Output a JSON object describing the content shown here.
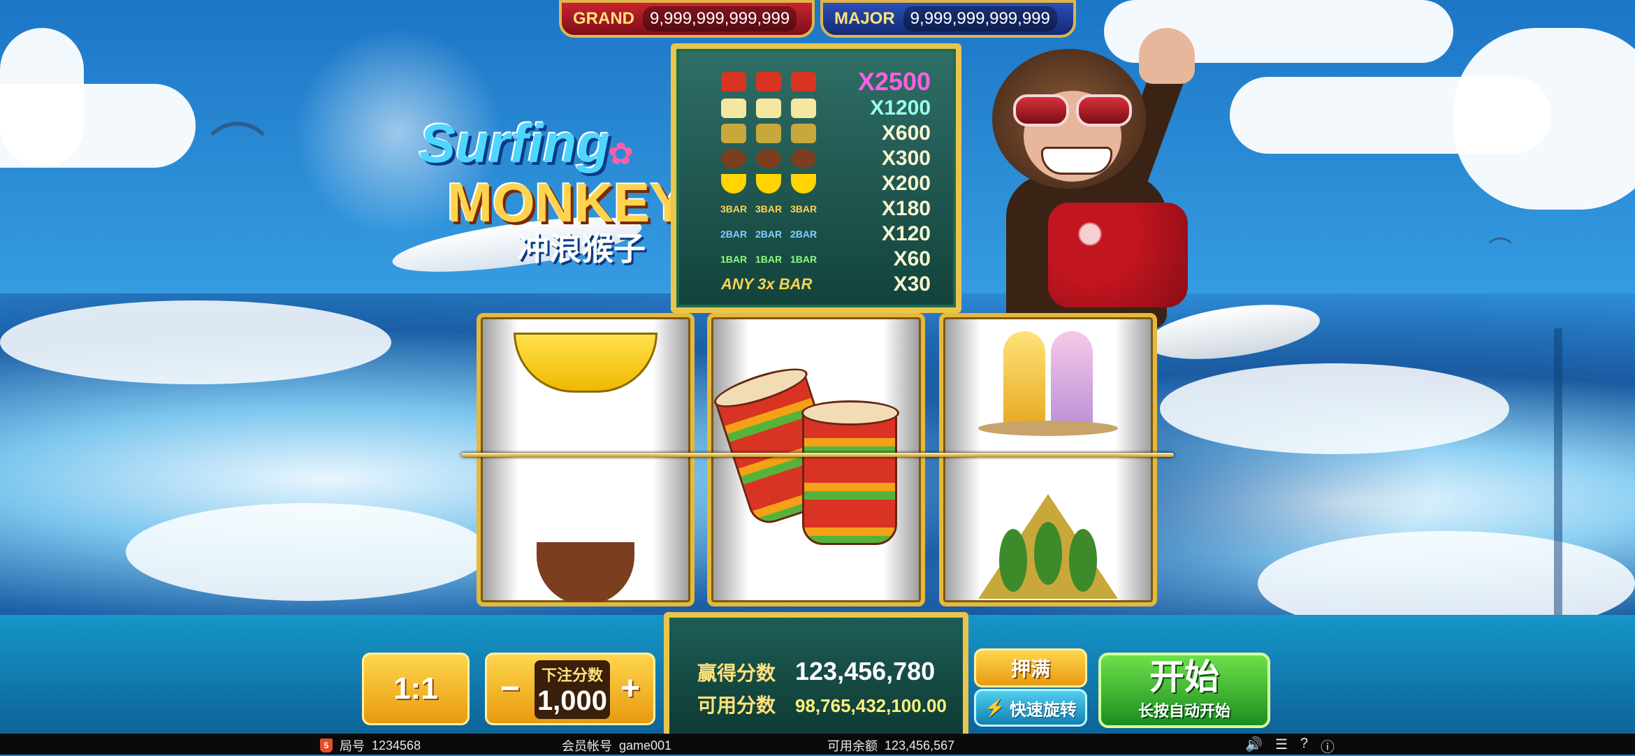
{
  "jackpots": {
    "grand": {
      "label": "GRAND",
      "value": "9,999,999,999,999"
    },
    "major": {
      "label": "MAJOR",
      "value": "9,999,999,999,999"
    }
  },
  "logo": {
    "line1": "Surfing",
    "line2": "MONKEY",
    "line3": "冲浪猴子"
  },
  "paytable": [
    {
      "symbols": [
        "drum",
        "drum",
        "drum"
      ],
      "multiplier": "X2500"
    },
    {
      "symbols": [
        "surfboard",
        "surfboard",
        "surfboard"
      ],
      "multiplier": "X1200"
    },
    {
      "symbols": [
        "hut",
        "hut",
        "hut"
      ],
      "multiplier": "X600"
    },
    {
      "symbols": [
        "coconut",
        "coconut",
        "coconut"
      ],
      "multiplier": "X300"
    },
    {
      "symbols": [
        "banana",
        "banana",
        "banana"
      ],
      "multiplier": "X200"
    },
    {
      "symbols": [
        "3BAR",
        "3BAR",
        "3BAR"
      ],
      "multiplier": "X180"
    },
    {
      "symbols": [
        "2BAR",
        "2BAR",
        "2BAR"
      ],
      "multiplier": "X120"
    },
    {
      "symbols": [
        "1BAR",
        "1BAR",
        "1BAR"
      ],
      "multiplier": "X60"
    },
    {
      "any_label": "ANY 3x BAR",
      "multiplier": "X30"
    }
  ],
  "reels": [
    {
      "top": "banana",
      "bottom": "coconut"
    },
    {
      "center": "drums"
    },
    {
      "top": "surfboards",
      "bottom": "hut"
    }
  ],
  "controls": {
    "ratio_label": "1:1",
    "bet_title": "下注分数",
    "bet_value": "1,000",
    "minus": "−",
    "plus": "+",
    "win_label": "赢得分数",
    "win_value": "123,456,780",
    "credit_label": "可用分数",
    "credit_value": "98,765,432,100.00",
    "max_bet": "押满",
    "fast_spin": "快速旋转",
    "start": "开始",
    "start_hint": "长按自动开始"
  },
  "status_bar": {
    "round_label": "局号",
    "round_value": "1234568",
    "account_label": "会员帐号",
    "account_value": "game001",
    "balance_label": "可用余额",
    "balance_value": "123,456,567",
    "icons": [
      "volume-icon",
      "history-icon",
      "help-icon",
      "info-icon"
    ]
  },
  "colors": {
    "gold": "#e9c54c",
    "panel": "#1d5d55",
    "start_green": "#2aa532",
    "grand_red": "#c8242f",
    "major_blue": "#2a4fb8"
  }
}
